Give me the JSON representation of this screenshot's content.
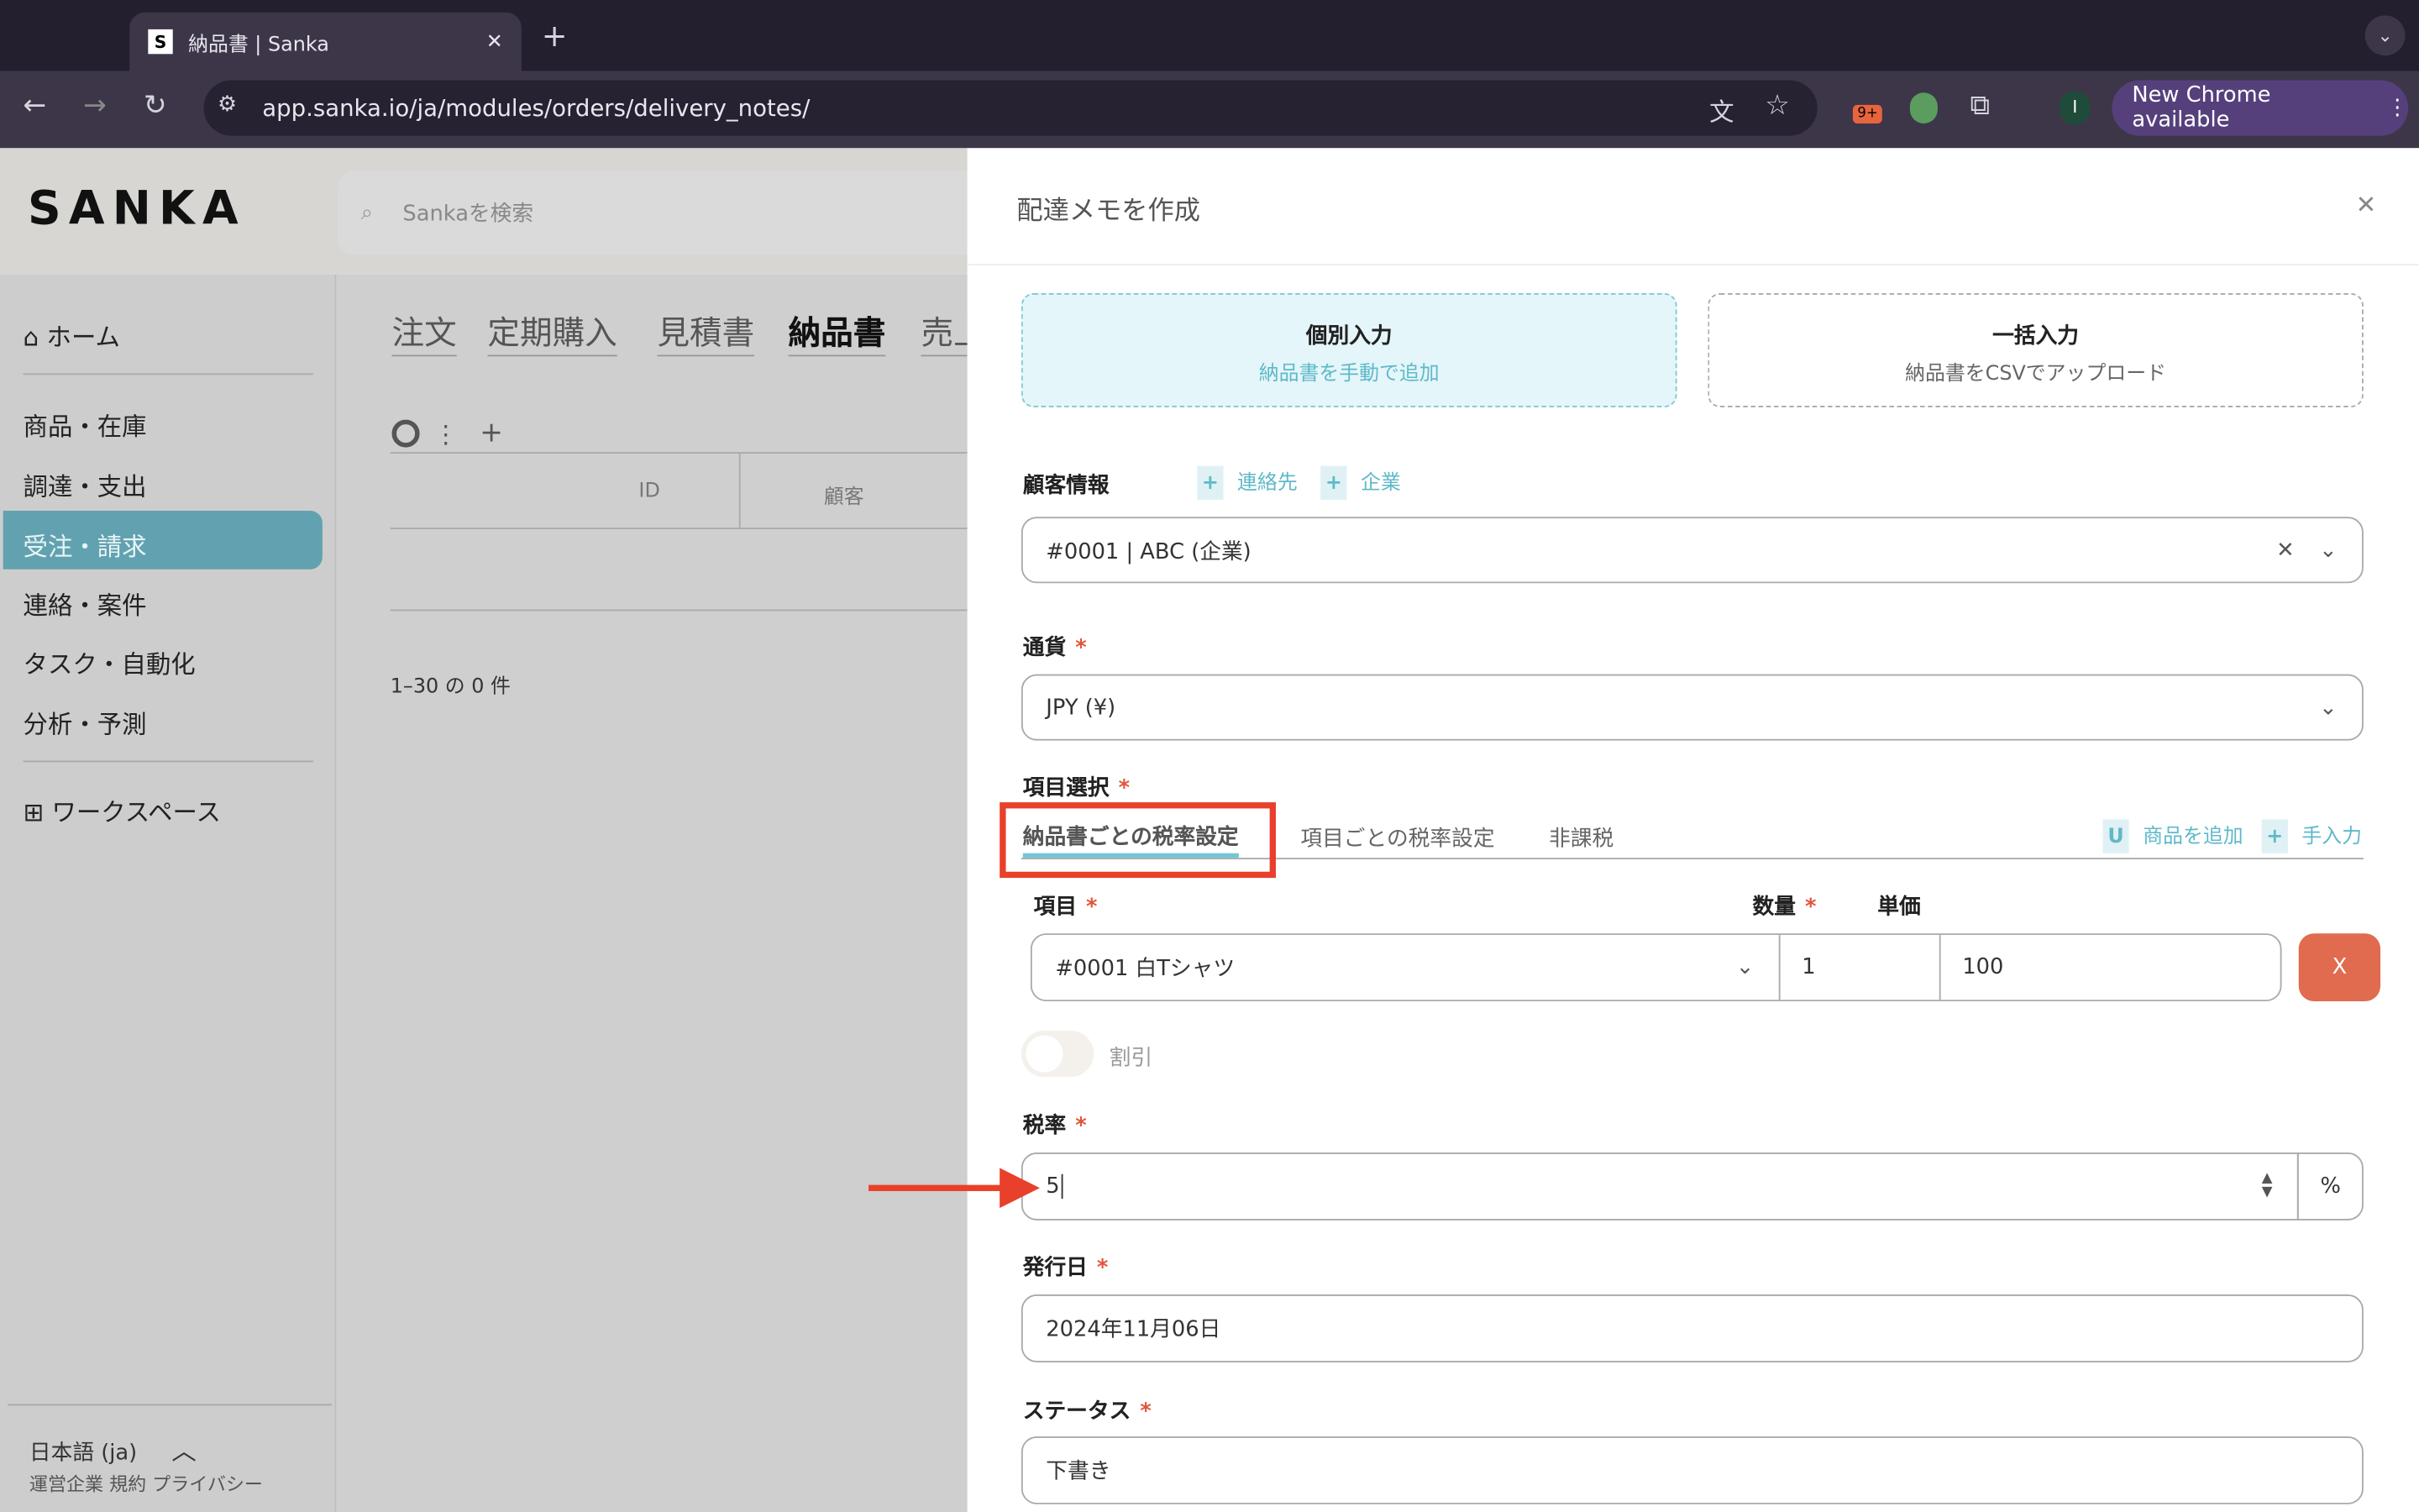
{
  "browser": {
    "tab_title": "納品書 | Sanka",
    "favicon": "S",
    "url": "app.sanka.io/ja/modules/orders/delivery_notes/",
    "new_chrome": "New Chrome available",
    "ext_badge": "9+",
    "profile": "I"
  },
  "app": {
    "logo": "SANKA",
    "search_placeholder": "Sankaを検索",
    "sidebar": {
      "home": "ホーム",
      "items": [
        "商品・在庫",
        "調達・支出",
        "受注・請求",
        "連絡・案件",
        "タスク・自動化",
        "分析・予測"
      ],
      "workspace": "ワークスペース",
      "language": "日本語 (ja)",
      "footer": "運営企業 規約 プライバシー"
    },
    "tabs": [
      "注文",
      "定期購入",
      "見積書",
      "納品書",
      "売上"
    ],
    "table": {
      "columns": [
        "ID",
        "顧客"
      ],
      "count": "1–30 の 0 件"
    }
  },
  "panel": {
    "title": "配達メモを作成",
    "modes": [
      {
        "title": "個別入力",
        "subtitle": "納品書を手動で追加"
      },
      {
        "title": "一括入力",
        "subtitle": "納品書をCSVでアップロード"
      }
    ],
    "customer": {
      "label": "顧客情報",
      "add_contact": "連絡先",
      "add_company": "企業",
      "value": "#0001 | ABC (企業)"
    },
    "currency": {
      "label": "通貨",
      "value": "JPY (¥)"
    },
    "items": {
      "label": "項目選択",
      "tabs": [
        "納品書ごとの税率設定",
        "項目ごとの税率設定",
        "非課税"
      ],
      "add_product": "商品を追加",
      "manual": "手入力",
      "col_item": "項目",
      "col_qty": "数量",
      "col_price": "単価",
      "row": {
        "item": "#0001 白Tシャツ",
        "qty": "1",
        "price": "100"
      },
      "remove": "X",
      "discount": "割引",
      "discount_on": false
    },
    "tax": {
      "label": "税率",
      "value": "5",
      "unit": "%"
    },
    "issue_date": {
      "label": "発行日",
      "value": "2024年11月06日"
    },
    "status": {
      "label": "ステータス",
      "value": "下書き"
    },
    "required_mark": "*"
  },
  "colors": {
    "accent": "#5fb9c9",
    "highlight": "#e8402a",
    "remove": "#e06b4f"
  }
}
